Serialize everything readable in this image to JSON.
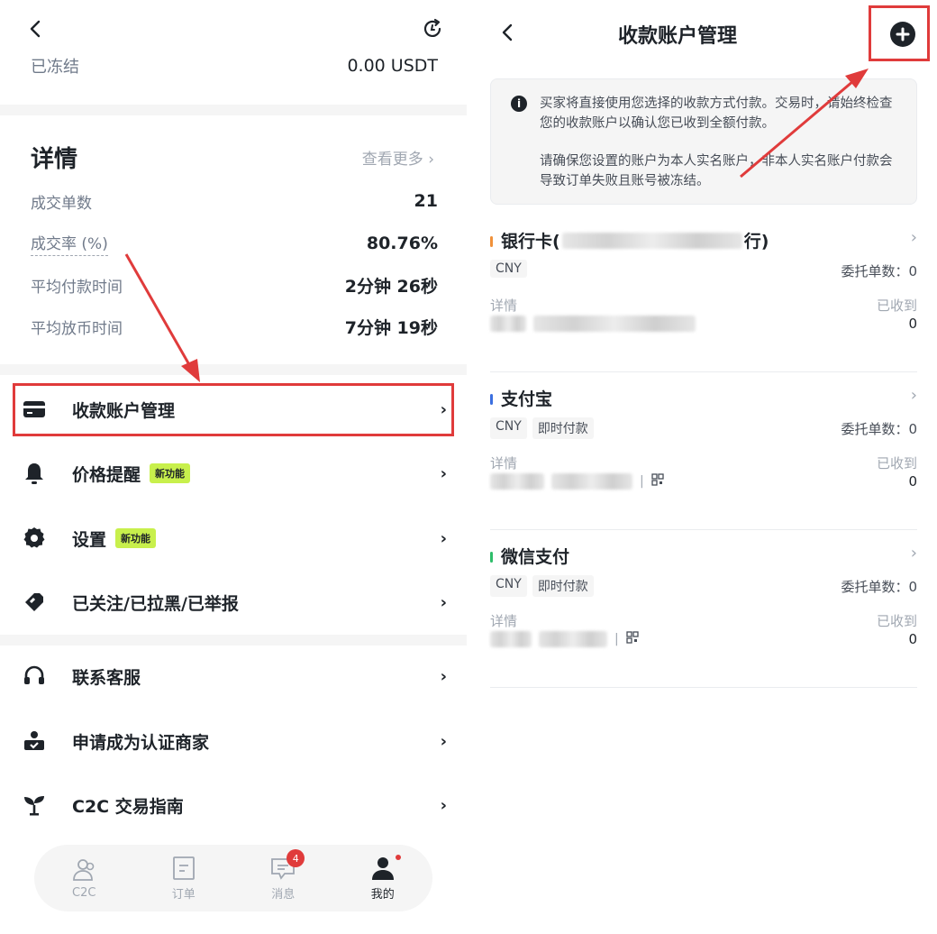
{
  "left": {
    "frozen": {
      "label": "已冻结",
      "value": "0.00 USDT"
    },
    "details": {
      "title": "详情",
      "see_more": "查看更多 ›",
      "stats": [
        {
          "label": "成交单数",
          "value": "21"
        },
        {
          "label": "成交率 (%)",
          "value": "80.76%"
        },
        {
          "label": "平均付款时间",
          "value": "2分钟 26秒"
        },
        {
          "label": "平均放币时间",
          "value": "7分钟 19秒"
        }
      ]
    },
    "menu": [
      {
        "label": "收款账户管理",
        "icon": "card-icon"
      },
      {
        "label": "价格提醒",
        "icon": "bell-icon",
        "badge": "新功能"
      },
      {
        "label": "设置",
        "icon": "gear-icon",
        "badge": "新功能"
      },
      {
        "label": "已关注/已拉黑/已举报",
        "icon": "tag-icon"
      },
      {
        "label": "联系客服",
        "icon": "headset-icon"
      },
      {
        "label": "申请成为认证商家",
        "icon": "merchant-icon"
      },
      {
        "label": "C2C 交易指南",
        "icon": "sprout-icon"
      }
    ],
    "tabbar": [
      {
        "label": "C2C",
        "icon": "users-icon"
      },
      {
        "label": "订单",
        "icon": "order-icon"
      },
      {
        "label": "消息",
        "icon": "message-icon",
        "badge": "4"
      },
      {
        "label": "我的",
        "icon": "profile-icon",
        "active": true
      }
    ]
  },
  "right": {
    "title": "收款账户管理",
    "notice": {
      "line1": "买家将直接使用您选择的收款方式付款。交易时，请始终检查您的收款账户以确认您已收到全额付款。",
      "line2": "请确保您设置的账户为本人实名账户，非本人实名账户付款会导致订单失败且账号被冻结。"
    },
    "accounts": [
      {
        "name": "银行卡(",
        "name_suffix": "行)",
        "bar_color": "#f0913a",
        "tags": [
          "CNY"
        ],
        "orders": "委托单数：0",
        "detail_label": "详情",
        "received_label": "已收到",
        "received_value": "0",
        "qr": false
      },
      {
        "name": "支付宝",
        "name_suffix": "",
        "bar_color": "#3b6fe0",
        "tags": [
          "CNY",
          "即时付款"
        ],
        "orders": "委托单数：0",
        "detail_label": "详情",
        "received_label": "已收到",
        "received_value": "0",
        "qr": true
      },
      {
        "name": "微信支付",
        "name_suffix": "",
        "bar_color": "#2ebd6a",
        "tags": [
          "CNY",
          "即时付款"
        ],
        "orders": "委托单数：0",
        "detail_label": "详情",
        "received_label": "已收到",
        "received_value": "0",
        "qr": true
      }
    ]
  }
}
